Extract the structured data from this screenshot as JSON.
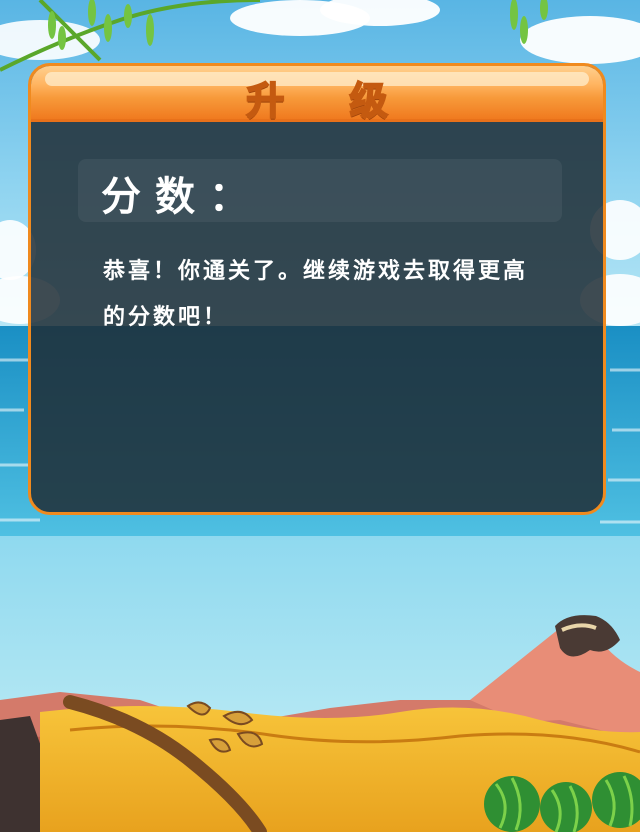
{
  "dialog": {
    "title": "升  级",
    "score_label": "分数：",
    "message": "恭喜！你通关了。继续游戏去取得更高的分数吧！"
  },
  "colors": {
    "sky_top": "#5fb8e6",
    "sky_bottom": "#c6ecf7",
    "sea": "#1f97c9",
    "dialog_border": "#f08a1e",
    "dialog_fill": "#1f2d36",
    "title_text": "#ffd85a"
  }
}
